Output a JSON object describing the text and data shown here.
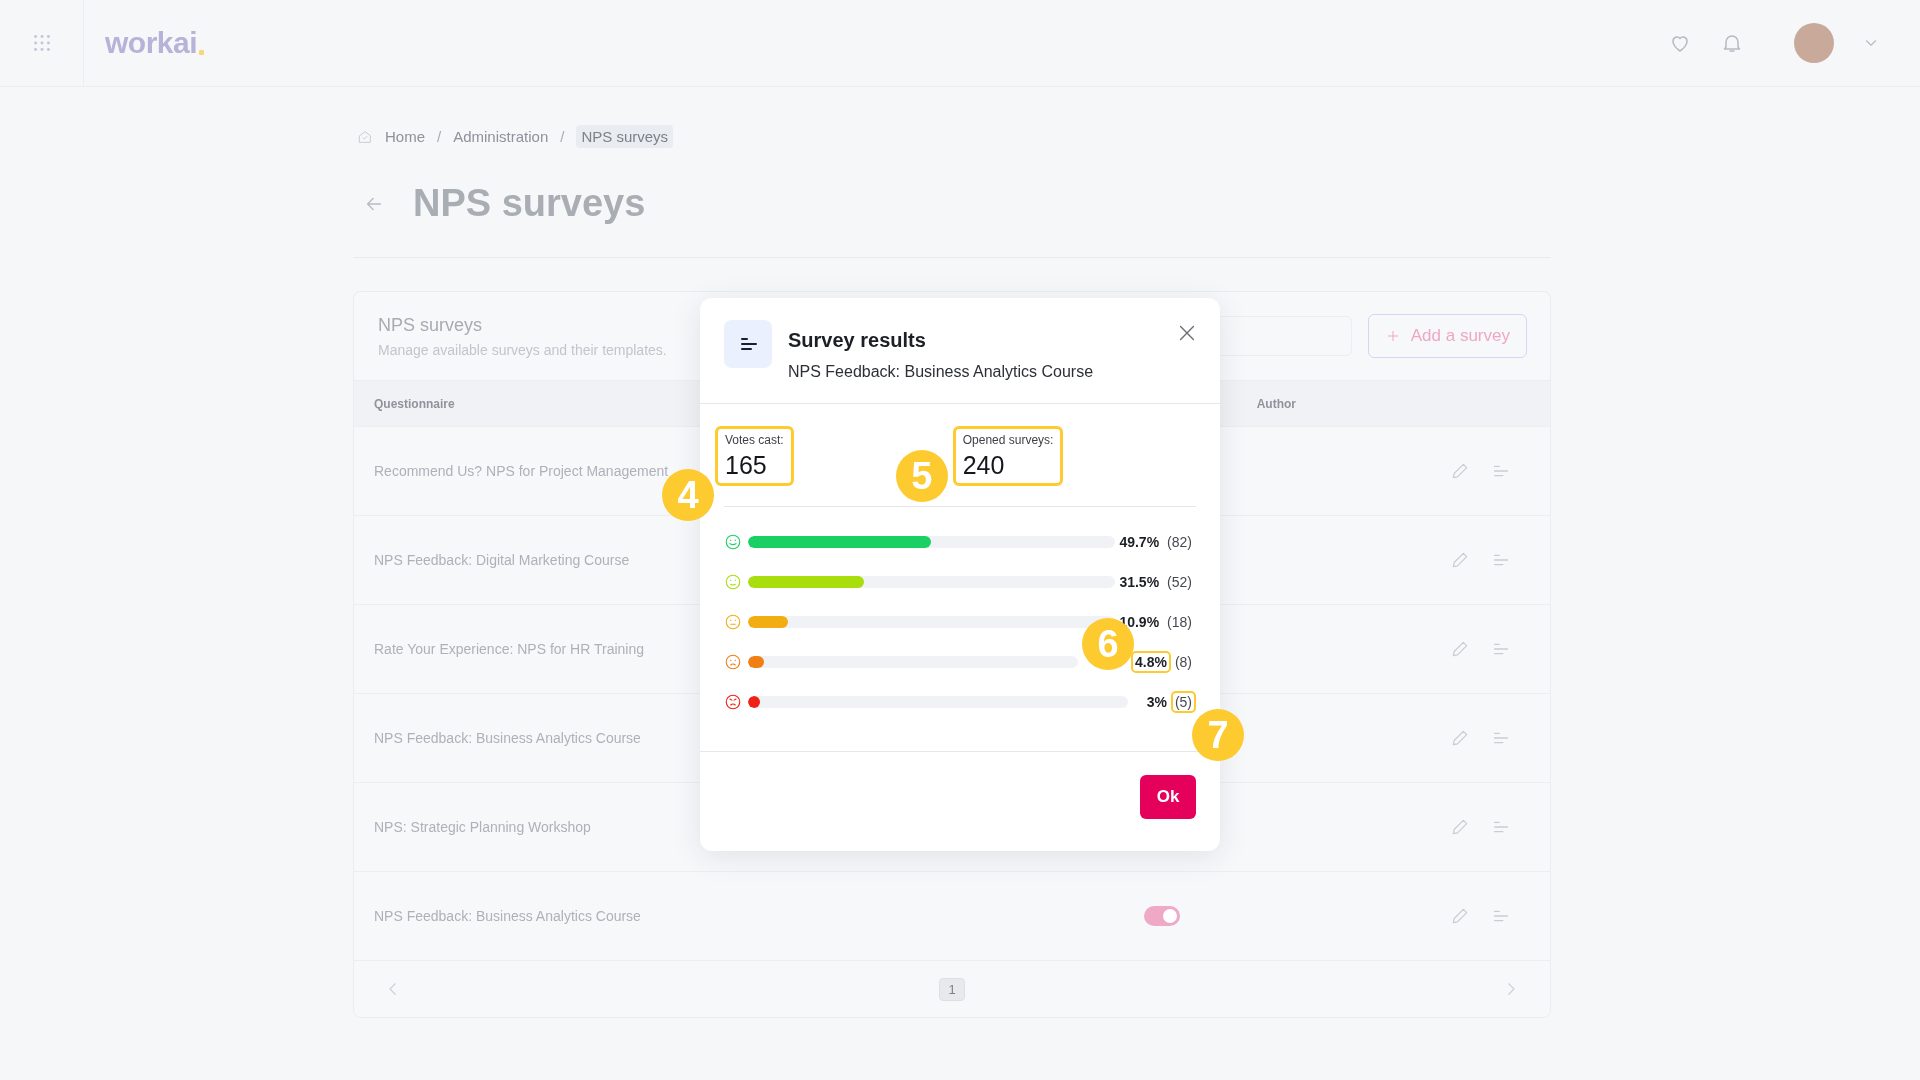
{
  "header": {
    "logo": "workai"
  },
  "breadcrumb": [
    {
      "label": "Home",
      "selected": false
    },
    {
      "label": "/",
      "kind": "sep"
    },
    {
      "label": "Administration",
      "selected": false
    },
    {
      "label": "/",
      "kind": "sep"
    },
    {
      "label": "NPS surveys",
      "selected": true
    }
  ],
  "page_title": "NPS surveys",
  "card": {
    "title": "NPS surveys",
    "subtitle": "Manage available surveys and their templates.",
    "add_button": "Add a survey",
    "columns": [
      "Questionnaire",
      "Author"
    ],
    "rows": [
      {
        "questionnaire": "Recommend Us? NPS for Project Management"
      },
      {
        "questionnaire": "NPS Feedback: Digital Marketing Course"
      },
      {
        "questionnaire": "Rate Your Experience: NPS for HR Training"
      },
      {
        "questionnaire": "NPS Feedback: Business Analytics Course"
      },
      {
        "questionnaire": "NPS: Strategic Planning Workshop"
      },
      {
        "questionnaire": "NPS Feedback: Business Analytics Course",
        "toggle": {
          "on": true
        }
      }
    ],
    "pagination": {
      "pages": [
        {
          "label": "1",
          "selected": true
        }
      ]
    }
  },
  "modal": {
    "title": "Survey results",
    "subtitle": "NPS Feedback: Business Analytics Course",
    "stats": [
      {
        "label": "Votes cast:",
        "value": "165",
        "highlighted": true,
        "callout": "4"
      },
      {
        "label": "Opened surveys:",
        "value": "240",
        "highlighted": true,
        "callout": "5"
      }
    ],
    "results": [
      {
        "kind": "very-happy",
        "color": "#1ad063",
        "level": 0.497,
        "percent": "49.7%",
        "count": "(82)",
        "percent_highlighted": false,
        "count_highlighted": false
      },
      {
        "kind": "happy",
        "color": "#a8dd0e",
        "level": 0.315,
        "percent": "31.5%",
        "count": "(52)",
        "percent_highlighted": false,
        "count_highlighted": false
      },
      {
        "kind": "neutral",
        "color": "#f2ad12",
        "level": 0.109,
        "percent": "10.9%",
        "count": "(18)",
        "percent_highlighted": false,
        "count_highlighted": false
      },
      {
        "kind": "sad",
        "color": "#f07f14",
        "level": 0.048,
        "percent": "4.8%",
        "count": "(8)",
        "percent_highlighted": true,
        "count_highlighted": false,
        "callout": "6"
      },
      {
        "kind": "angry",
        "color": "#ee2216",
        "level": 0.03,
        "percent": "3%",
        "count": "(5)",
        "percent_highlighted": false,
        "count_highlighted": true,
        "callout": "7"
      }
    ],
    "ok_button": "Ok"
  }
}
